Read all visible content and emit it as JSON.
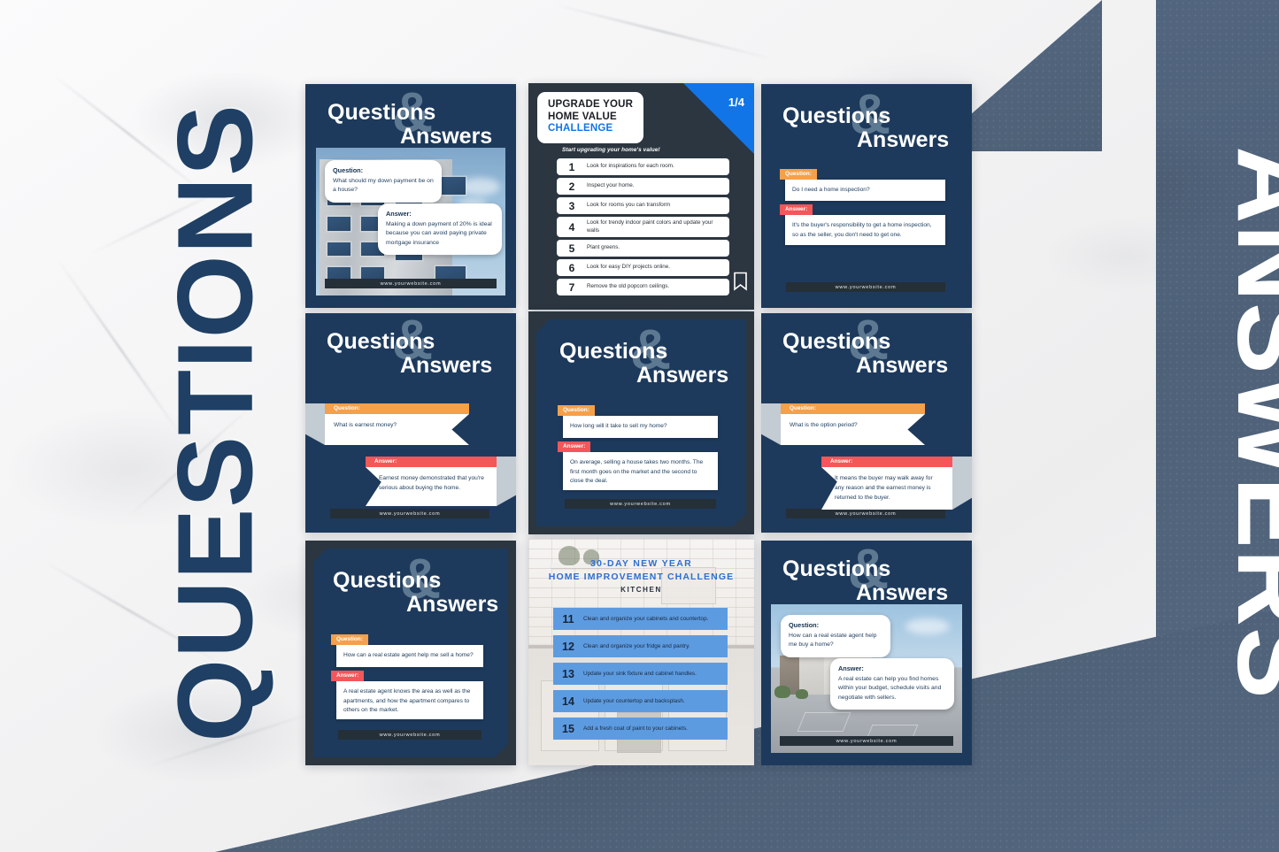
{
  "side_labels": {
    "left": "QUESTIONS",
    "right": "ANSWERS"
  },
  "colors": {
    "navy": "#1d3a5c",
    "dark_frame": "#2c3640",
    "slate": "#52657f",
    "accent_blue": "#1175e8",
    "question_tag": "#f5a04a",
    "answer_tag": "#f4565a",
    "kitchen_row": "#5d9be0",
    "marble": "#f4f4f4"
  },
  "common": {
    "title_q": "Questions",
    "title_a": "Answers",
    "ampersand": "&",
    "question_label": "Question:",
    "answer_label": "Answer:",
    "website": "www.yourwebsite.com"
  },
  "cards": [
    {
      "id": "card-down-payment",
      "type": "photo-qa",
      "position": "row1-col1",
      "title_q": "Questions",
      "title_a": "Answers",
      "question_label": "Question:",
      "question": "What should my down payment be on a house?",
      "answer_label": "Answer:",
      "answer": "Making a down payment of 20% is ideal because you can avoid paying private mortgage insurance",
      "website": "www.yourwebsite.com",
      "photo": "apartment-building-photo"
    },
    {
      "id": "card-upgrade-challenge",
      "type": "checklist",
      "position": "row1-col2",
      "title_line1": "UPGRADE YOUR",
      "title_line2": "HOME VALUE",
      "title_line3": "CHALLENGE",
      "page_badge": "1/4",
      "subtitle": "Start upgrading your home's value!",
      "bookmark_icon": "bookmark-icon",
      "items": [
        {
          "number": "1",
          "text": "Look for inspirations for each room."
        },
        {
          "number": "2",
          "text": "Inspect your home."
        },
        {
          "number": "3",
          "text": "Look for rooms you can transform"
        },
        {
          "number": "4",
          "text": "Look for trendy indoor paint colors and update your walls"
        },
        {
          "number": "5",
          "text": "Plant greens."
        },
        {
          "number": "6",
          "text": "Look for easy DIY projects online."
        },
        {
          "number": "7",
          "text": "Remove the old popcorn ceilings."
        }
      ]
    },
    {
      "id": "card-home-inspection",
      "type": "flat-qa",
      "position": "row1-col3",
      "title_q": "Questions",
      "title_a": "Answers",
      "question_label": "Question:",
      "question": "Do I need a home inspection?",
      "answer_label": "Answer:",
      "answer": "It's the buyer's responsibility to get a home inspection, so as the seller, you don't need to get one.",
      "website": "www.yourwebsite.com"
    },
    {
      "id": "card-earnest-money",
      "type": "ribbon-qa",
      "position": "row2-col1",
      "title_q": "Questions",
      "title_a": "Answers",
      "question_label": "Question:",
      "question": "What is earnest money?",
      "answer_label": "Answer:",
      "answer": "Earnest money demonstrated that you're serious about buying the home.",
      "website": "www.yourwebsite.com"
    },
    {
      "id": "card-time-to-sell",
      "type": "framed-qa",
      "position": "row2-col2",
      "title_q": "Questions",
      "title_a": "Answers",
      "question_label": "Question:",
      "question": "How long will it take to sell my home?",
      "answer_label": "Answer:",
      "answer": "On average, selling a house takes two months. The first month goes on the market and the second to close the deal.",
      "website": "www.yourwebsite.com"
    },
    {
      "id": "card-option-period",
      "type": "ribbon-qa",
      "position": "row2-col3",
      "title_q": "Questions",
      "title_a": "Answers",
      "question_label": "Question:",
      "question": "What is the option period?",
      "answer_label": "Answer:",
      "answer": "It means the buyer may walk away for any reason and the earnest money is returned to the buyer.",
      "website": "www.yourwebsite.com"
    },
    {
      "id": "card-agent-sell",
      "type": "framed-qa",
      "position": "row3-col1",
      "title_q": "Questions",
      "title_a": "Answers",
      "question_label": "Question:",
      "question": "How can a real estate agent help me sell a home?",
      "answer_label": "Answer:",
      "answer": "A real estate agent knows the area as well as the apartments, and how the apartment compares to others on the market.",
      "website": "www.yourwebsite.com"
    },
    {
      "id": "card-kitchen-challenge",
      "type": "kitchen-checklist",
      "position": "row3-col2",
      "title_line1": "30-DAY NEW YEAR",
      "title_line2": "HOME IMPROVEMENT CHALLENGE",
      "title_line3": "KITCHEN",
      "items": [
        {
          "number": "11",
          "text": "Clean and organize your cabinets and countertop."
        },
        {
          "number": "12",
          "text": "Clean and organize your fridge and pantry."
        },
        {
          "number": "13",
          "text": "Update your sink fixture and cabinet handles."
        },
        {
          "number": "14",
          "text": "Update your countertop and backsplash."
        },
        {
          "number": "15",
          "text": "Add a fresh coat of paint to your cabinets."
        }
      ]
    },
    {
      "id": "card-agent-buy",
      "type": "photo-qa",
      "position": "row3-col3",
      "title_q": "Questions",
      "title_a": "Answers",
      "question_label": "Question:",
      "question": "How can a real estate agent help me buy a home?",
      "answer_label": "Answer:",
      "answer": "A real estate can help you find homes within your budget, schedule visits and negotiate with sellers.",
      "website": "www.yourwebsite.com",
      "photo": "modern-house-driveway-photo"
    }
  ]
}
